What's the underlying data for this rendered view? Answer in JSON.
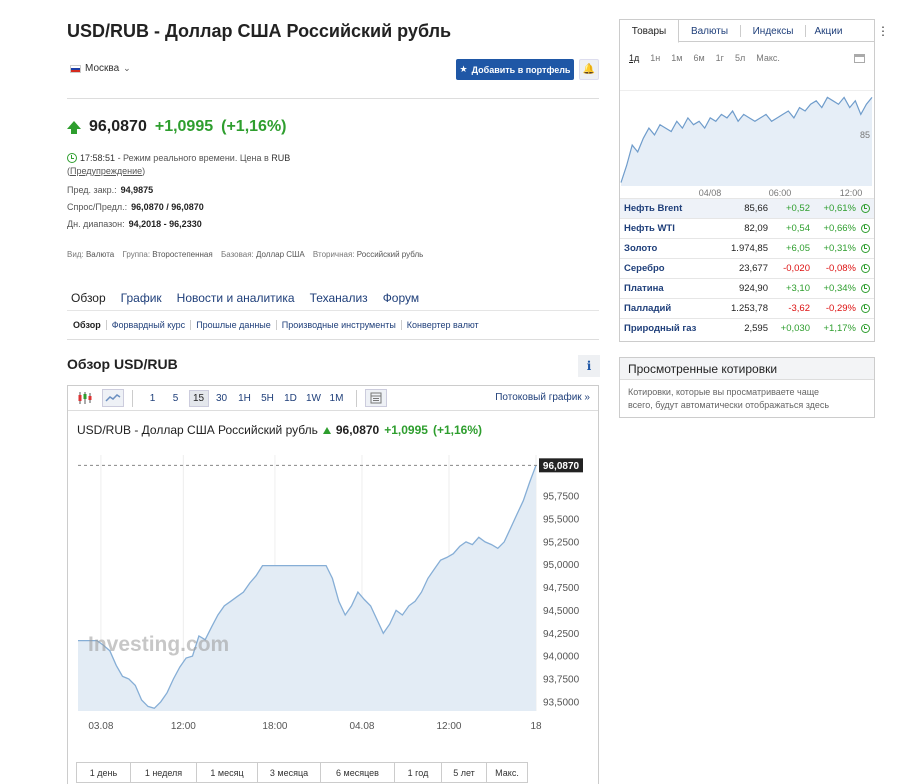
{
  "header": {
    "title": "USD/RUB - Доллар США Российский рубль",
    "location": "Москва",
    "add_button": "Добавить в портфель"
  },
  "quote": {
    "price": "96,0870",
    "change": "+1,0995",
    "change_pct": "(+1,16%)",
    "time": "17:58:51",
    "realtime_text": "- Режим реального времени.",
    "currency_text": "Цена в",
    "currency": "RUB",
    "warning": "Предупреждение",
    "prev_close_label": "Пред. закр.:",
    "prev_close": "94,9875",
    "bid_ask_label": "Спрос/Предл.:",
    "bid_ask": "96,0870 / 96,0870",
    "day_range_label": "Дн. диапазон:",
    "day_range": "94,2018 - 96,2330"
  },
  "info_line": {
    "type_label": "Вид:",
    "type": "Валюта",
    "group_label": "Группа:",
    "group": "Второстепенная",
    "base_label": "Базовая:",
    "base": "Доллар США",
    "secondary_label": "Вторичная:",
    "secondary": "Российский рубль"
  },
  "main_tabs": [
    "Обзор",
    "График",
    "Новости и аналитика",
    "Теханализ",
    "Форум"
  ],
  "sub_tabs": [
    "Обзор",
    "Форвардный курс",
    "Прошлые данные",
    "Производные инструменты",
    "Конвертер валют"
  ],
  "overview": {
    "title": "Обзор USD/RUB",
    "info_icon": "i"
  },
  "chart_toolbar": {
    "intervals": [
      "1",
      "5",
      "15",
      "30",
      "1H",
      "5H",
      "1D",
      "1W",
      "1M"
    ],
    "active_interval": "15",
    "stream_link": "Потоковый график »"
  },
  "chart_header": {
    "name": "USD/RUB - Доллар США Российский рубль",
    "price": "96,0870",
    "change": "+1,0995",
    "change_pct": "(+1,16%)"
  },
  "chart_data": {
    "type": "area",
    "title": "USD/RUB - Доллар США Российский рубль",
    "x_labels": [
      "03.08",
      "12:00",
      "18:00",
      "04.08",
      "12:00",
      "18"
    ],
    "y_ticks": [
      "93,5000",
      "93,7500",
      "94,0000",
      "94,2500",
      "94,5000",
      "94,7500",
      "95,0000",
      "95,2500",
      "95,5000",
      "95,7500",
      "96,0000"
    ],
    "ylim": [
      93.4,
      96.2
    ],
    "last_value_label": "96,0870",
    "last_value": 96.087,
    "watermark": "Investing.com",
    "grid": "vertical",
    "values": [
      94.17,
      94.17,
      94.17,
      94.17,
      94.12,
      94.06,
      93.9,
      93.78,
      93.75,
      93.68,
      93.52,
      93.45,
      93.43,
      93.5,
      93.6,
      93.75,
      93.88,
      93.98,
      94.0,
      94.22,
      94.18,
      94.32,
      94.45,
      94.55,
      94.6,
      94.65,
      94.7,
      94.8,
      94.88,
      94.99,
      94.99,
      94.99,
      94.99,
      94.99,
      94.99,
      94.99,
      94.99,
      94.99,
      94.99,
      94.99,
      94.85,
      94.6,
      94.45,
      94.55,
      94.7,
      94.62,
      94.55,
      94.4,
      94.25,
      94.35,
      94.5,
      94.45,
      94.55,
      94.6,
      94.7,
      94.85,
      94.95,
      95.05,
      95.08,
      95.12,
      95.2,
      95.25,
      95.22,
      95.3,
      95.25,
      95.22,
      95.18,
      95.25,
      95.4,
      95.55,
      95.7,
      95.9,
      96.087
    ]
  },
  "range_buttons": [
    "1 день",
    "1 неделя",
    "1 месяц",
    "3 месяца",
    "6 месяцев",
    "1 год",
    "5 лет",
    "Макс."
  ],
  "right_panel": {
    "tabs": [
      "Товары",
      "Валюты",
      "Индексы",
      "Акции"
    ],
    "active_tab": "Товары",
    "intervals": [
      "1д",
      "1н",
      "1м",
      "6м",
      "1г",
      "5л",
      "Макс."
    ],
    "active_interval": "1д",
    "mini_chart": {
      "x_labels": [
        "04/08",
        "06:00",
        "12:00"
      ],
      "y_label": "85",
      "values": [
        83.7,
        84.2,
        84.8,
        84.6,
        85.0,
        85.3,
        85.1,
        85.4,
        85.3,
        85.2,
        85.5,
        85.3,
        85.6,
        85.4,
        85.5,
        85.3,
        85.6,
        85.5,
        85.7,
        85.6,
        85.8,
        85.5,
        85.7,
        85.6,
        85.5,
        85.6,
        85.7,
        85.5,
        85.6,
        85.7,
        85.8,
        85.6,
        85.9,
        85.8,
        86.0,
        86.1,
        85.9,
        86.2,
        86.1,
        86.0,
        86.2,
        85.9,
        86.1,
        85.7,
        86.0,
        86.2
      ]
    },
    "rows": [
      {
        "name": "Нефть Brent",
        "value": "85,66",
        "change": "+0,52",
        "pct": "+0,61%",
        "dir": "pos"
      },
      {
        "name": "Нефть WTI",
        "value": "82,09",
        "change": "+0,54",
        "pct": "+0,66%",
        "dir": "pos"
      },
      {
        "name": "Золото",
        "value": "1.974,85",
        "change": "+6,05",
        "pct": "+0,31%",
        "dir": "pos"
      },
      {
        "name": "Серебро",
        "value": "23,677",
        "change": "-0,020",
        "pct": "-0,08%",
        "dir": "neg"
      },
      {
        "name": "Платина",
        "value": "924,90",
        "change": "+3,10",
        "pct": "+0,34%",
        "dir": "pos"
      },
      {
        "name": "Палладий",
        "value": "1.253,78",
        "change": "-3,62",
        "pct": "-0,29%",
        "dir": "neg"
      },
      {
        "name": "Природный газ",
        "value": "2,595",
        "change": "+0,030",
        "pct": "+1,17%",
        "dir": "pos"
      }
    ]
  },
  "viewed": {
    "title": "Просмотренные котировки",
    "text_line1": "Котировки, которые вы просматриваете чаще",
    "text_line2": "всего, будут автоматически отображаться здесь"
  },
  "colors": {
    "accent_blue": "#1f57a6",
    "positive": "#2e9e2e",
    "negative": "#dd1111",
    "area_fill": "#e3ecf5",
    "line": "#86aed6"
  }
}
